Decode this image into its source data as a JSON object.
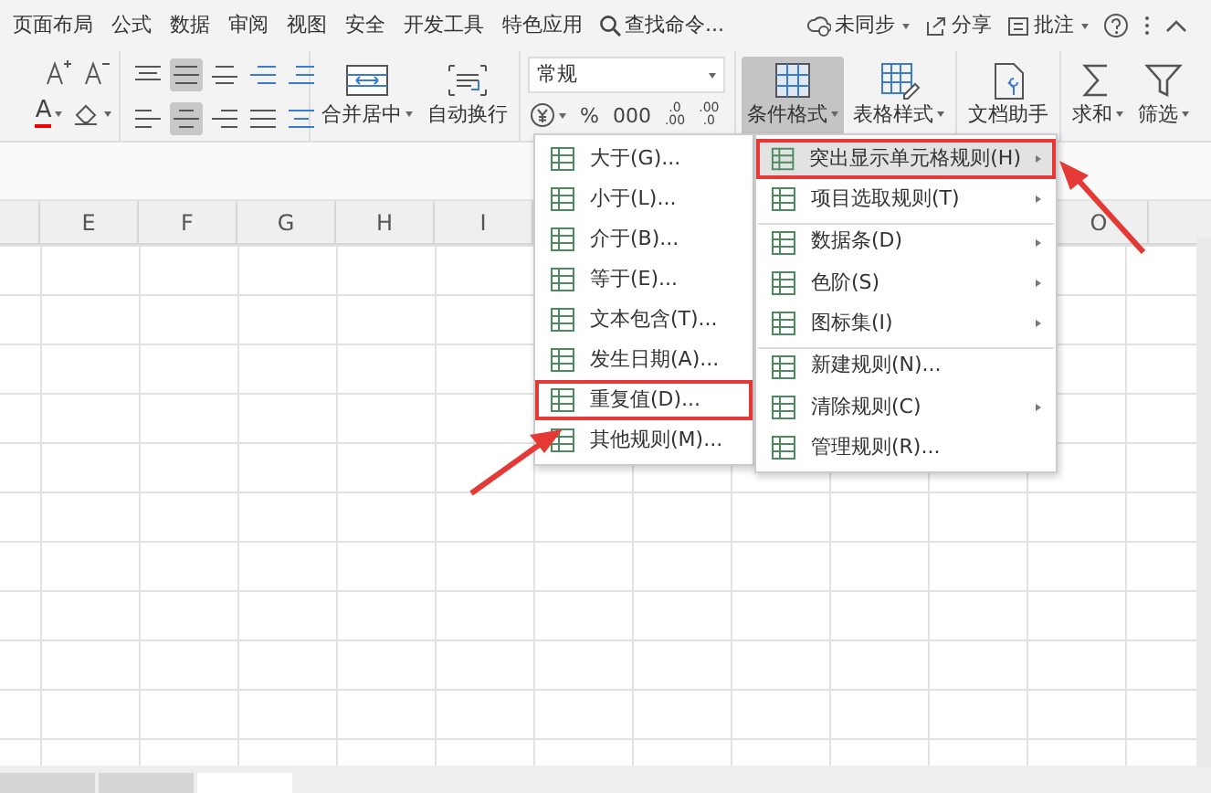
{
  "menu_tabs": [
    {
      "label": "页面布局"
    },
    {
      "label": "公式"
    },
    {
      "label": "数据"
    },
    {
      "label": "审阅"
    },
    {
      "label": "视图"
    },
    {
      "label": "安全"
    },
    {
      "label": "开发工具"
    },
    {
      "label": "特色应用"
    }
  ],
  "search": {
    "placeholder": "查找命令..."
  },
  "top_actions": [
    {
      "kind": "sync",
      "label": "未同步",
      "has_menu": true
    },
    {
      "kind": "share",
      "label": "分享",
      "has_menu": false
    },
    {
      "kind": "comment",
      "label": "批注",
      "has_menu": true
    }
  ],
  "ribbon": {
    "font_buttons": [
      {
        "kind": "grow"
      },
      {
        "kind": "shrink"
      },
      {
        "kind": "font-color",
        "text": "A"
      },
      {
        "kind": "clear"
      }
    ],
    "align_buttons": [
      {
        "kind": "top",
        "pressed": false
      },
      {
        "kind": "middle",
        "pressed": true
      },
      {
        "kind": "bottom",
        "pressed": false
      },
      {
        "kind": "outdent",
        "pressed": false
      },
      {
        "kind": "indent",
        "pressed": false
      },
      {
        "kind": "left",
        "pressed": false
      },
      {
        "kind": "center",
        "pressed": true
      },
      {
        "kind": "right",
        "pressed": false
      },
      {
        "kind": "justify",
        "pressed": false
      },
      {
        "kind": "distribute",
        "pressed": false
      }
    ],
    "merge_buttons": [
      {
        "kind": "merge",
        "label": "合并居中",
        "has_menu": true
      },
      {
        "kind": "wrap",
        "label": "自动换行",
        "has_menu": false
      }
    ],
    "number_format": {
      "value": "常规"
    },
    "number_buttons": [
      {
        "kind": "currency",
        "has_menu": true
      },
      {
        "kind": "text",
        "label": "%"
      },
      {
        "kind": "text",
        "label": "000"
      },
      {
        "kind": "stack",
        "top": ".0",
        "bottom": ".00"
      },
      {
        "kind": "stack",
        "top": ".00",
        "bottom": ".0"
      }
    ],
    "tool_buttons": [
      {
        "kind": "conditional",
        "label": "条件格式",
        "has_menu": true,
        "pressed": true
      },
      {
        "kind": "table-style",
        "label": "表格样式",
        "has_menu": true,
        "pressed": false
      },
      {
        "kind": "assistant",
        "label": "文档助手",
        "has_menu": false,
        "pressed": false
      },
      {
        "kind": "sum",
        "label": "求和",
        "has_menu": true,
        "pressed": false
      },
      {
        "kind": "filter",
        "label": "筛选",
        "has_menu": true,
        "pressed": false
      }
    ]
  },
  "column_headers": [
    {
      "label": "E",
      "gap_before": false
    },
    {
      "label": "F",
      "gap_before": false
    },
    {
      "label": "G",
      "gap_before": false
    },
    {
      "label": "H",
      "gap_before": false
    },
    {
      "label": "I",
      "gap_before": false
    },
    {
      "label": "O",
      "gap_before": true
    }
  ],
  "sheet_tabs": [
    {
      "selected": false
    },
    {
      "selected": false
    },
    {
      "selected": true
    }
  ],
  "submenu": [
    {
      "label": "大于(G)...",
      "outlined": false
    },
    {
      "label": "小于(L)...",
      "outlined": false
    },
    {
      "label": "介于(B)...",
      "outlined": false
    },
    {
      "label": "等于(E)...",
      "outlined": false
    },
    {
      "label": "文本包含(T)...",
      "outlined": false
    },
    {
      "label": "发生日期(A)...",
      "outlined": false
    },
    {
      "label": "重复值(D)...",
      "outlined": true
    },
    {
      "label": "其他规则(M)...",
      "outlined": false
    }
  ],
  "menu": [
    {
      "label": "突出显示单元格规则(H)",
      "selected": true,
      "outlined": true,
      "has_submenu": true,
      "separator_before": false
    },
    {
      "label": "项目选取规则(T)",
      "selected": false,
      "outlined": false,
      "has_submenu": true,
      "separator_before": false
    },
    {
      "label": "数据条(D)",
      "selected": false,
      "outlined": false,
      "has_submenu": true,
      "separator_before": true
    },
    {
      "label": "色阶(S)",
      "selected": false,
      "outlined": false,
      "has_submenu": true,
      "separator_before": false
    },
    {
      "label": "图标集(I)",
      "selected": false,
      "outlined": false,
      "has_submenu": true,
      "separator_before": false
    },
    {
      "label": "新建规则(N)...",
      "selected": false,
      "outlined": false,
      "has_submenu": false,
      "separator_before": true
    },
    {
      "label": "清除规则(C)",
      "selected": false,
      "outlined": false,
      "has_submenu": true,
      "separator_before": false
    },
    {
      "label": "管理规则(R)...",
      "selected": false,
      "outlined": false,
      "has_submenu": false,
      "separator_before": false
    }
  ]
}
